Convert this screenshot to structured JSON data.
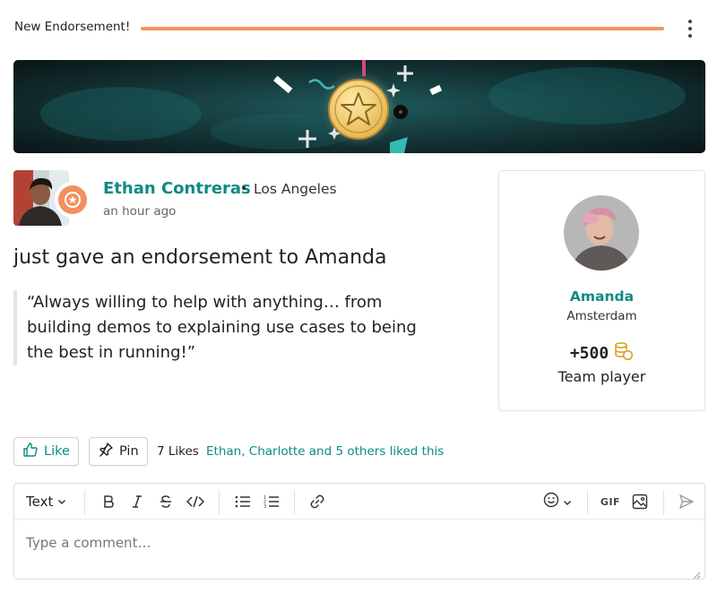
{
  "header": {
    "title": "New Endorsement!"
  },
  "author": {
    "name": "Ethan Contreras",
    "separator": "•",
    "location": "Los Angeles",
    "timestamp": "an hour ago"
  },
  "post": {
    "headline": "just gave an endorsement to Amanda",
    "quote": "“Always willing to help with anything… from building demos to explaining use cases to being the best in running!”"
  },
  "recipient": {
    "name": "Amanda",
    "location": "Amsterdam",
    "points": "+500",
    "award": "Team player"
  },
  "actions": {
    "like_label": "Like",
    "pin_label": "Pin",
    "likes_count": "7 Likes",
    "likes_text": "Ethan, Charlotte and 5 others liked this"
  },
  "editor": {
    "format_select": "Text",
    "placeholder": "Type a comment…",
    "gif_label": "GIF"
  },
  "colors": {
    "accent_teal": "#0d8a86",
    "accent_orange": "#f29667",
    "coin_gold": "#d9a521"
  },
  "icons": [
    "kebab-menu-icon",
    "star-badge-icon",
    "coins-icon",
    "thumbs-up-icon",
    "pin-icon",
    "bold-icon",
    "italic-icon",
    "strikethrough-icon",
    "code-icon",
    "bullet-list-icon",
    "numbered-list-icon",
    "link-icon",
    "emoji-icon",
    "chevron-down-icon",
    "gif-icon",
    "image-icon",
    "send-icon",
    "resize-handle-icon"
  ]
}
